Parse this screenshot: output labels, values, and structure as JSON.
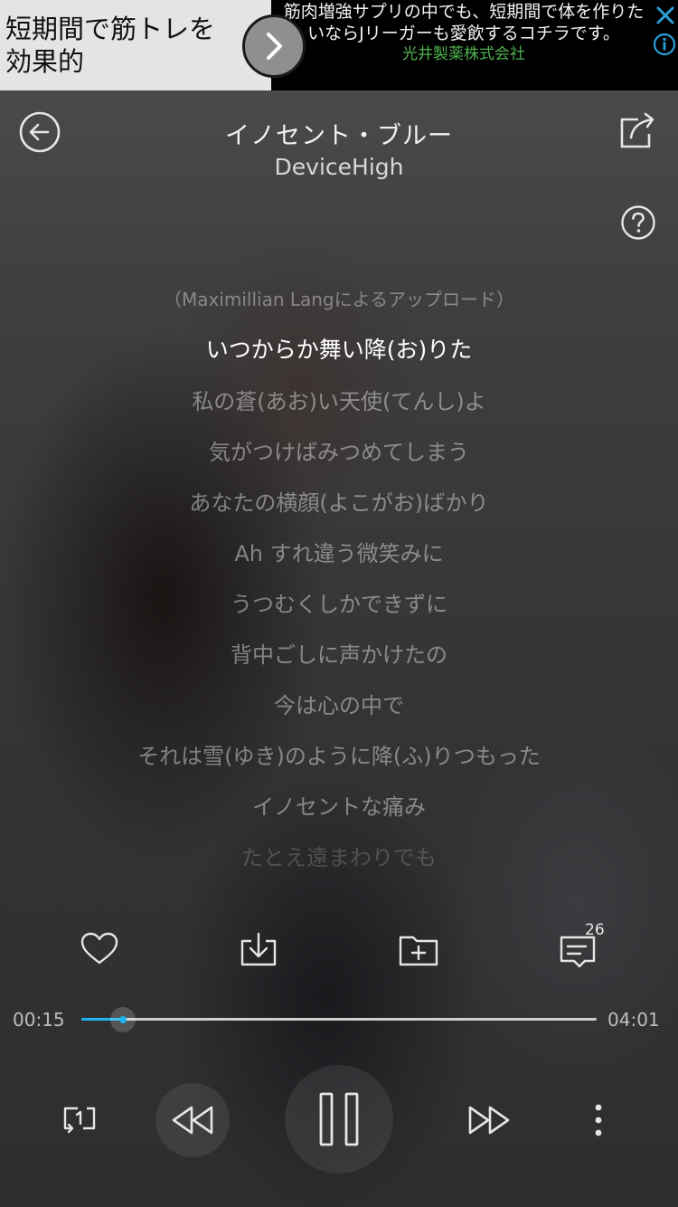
{
  "ad": {
    "headline": "短期間で筋トレを効果的",
    "body": "筋肉増強サプリの中でも、短期間で体を作りたいならJリーガーも愛飲するコチラです。",
    "sponsor": "光井製薬株式会社"
  },
  "player": {
    "title": "イノセント・ブルー",
    "artist": "DeviceHigh"
  },
  "lyrics": {
    "credit": "（Maximillian Langによるアップロード）",
    "lines": [
      "いつからか舞い降(お)りた",
      "私の蒼(あお)い天使(てんし)よ",
      "気がつけばみつめてしまう",
      "あなたの横顔(よこがお)ばかり",
      "Ah すれ違う微笑みに",
      "うつむくしかできずに",
      "背中ごしに声かけたの",
      "今は心の中で",
      "それは雪(ゆき)のように降(ふ)りつもった",
      "イノセントな痛み",
      "たとえ遠まわりでも"
    ]
  },
  "actions": {
    "comment_count": "26"
  },
  "progress": {
    "elapsed": "00:15",
    "duration": "04:01",
    "fraction": 0.081
  },
  "colors": {
    "accent": "#1fb6f0",
    "ad_sponsor": "#4fb14f"
  },
  "icons": {
    "back": "back-arrow-icon",
    "share": "share-icon",
    "help": "help-icon",
    "like": "heart-icon",
    "download": "download-icon",
    "add_to_folder": "folder-add-icon",
    "comments": "comment-icon",
    "repeat": "repeat-one-icon",
    "previous": "rewind-icon",
    "play_pause": "pause-icon",
    "next": "fast-forward-icon",
    "more": "more-vertical-icon"
  }
}
